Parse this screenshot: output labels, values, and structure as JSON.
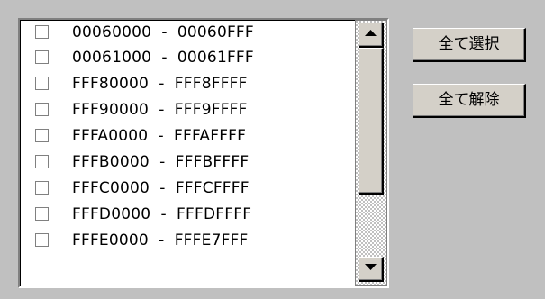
{
  "list": {
    "items": [
      {
        "label": "00060000  -  00060FFF",
        "checked": false
      },
      {
        "label": "00061000  -  00061FFF",
        "checked": false
      },
      {
        "label": "FFF80000  -  FFF8FFFF",
        "checked": false
      },
      {
        "label": "FFF90000  -  FFF9FFFF",
        "checked": false
      },
      {
        "label": "FFFA0000  -  FFFAFFFF",
        "checked": false
      },
      {
        "label": "FFFB0000  -  FFFBFFFF",
        "checked": false
      },
      {
        "label": "FFFC0000  -  FFFCFFFF",
        "checked": false
      },
      {
        "label": "FFFD0000  -  FFFDFFFF",
        "checked": false
      },
      {
        "label": "FFFE0000  -  FFFE7FFF",
        "checked": false
      }
    ]
  },
  "scrollbar": {
    "up_icon": "arrow-up-icon",
    "down_icon": "arrow-down-icon"
  },
  "buttons": {
    "select_all": "全て選択",
    "deselect_all": "全て解除"
  },
  "colors": {
    "face": "#d4d0c8",
    "background": "#c0c0c0",
    "list_background": "#ffffff"
  }
}
